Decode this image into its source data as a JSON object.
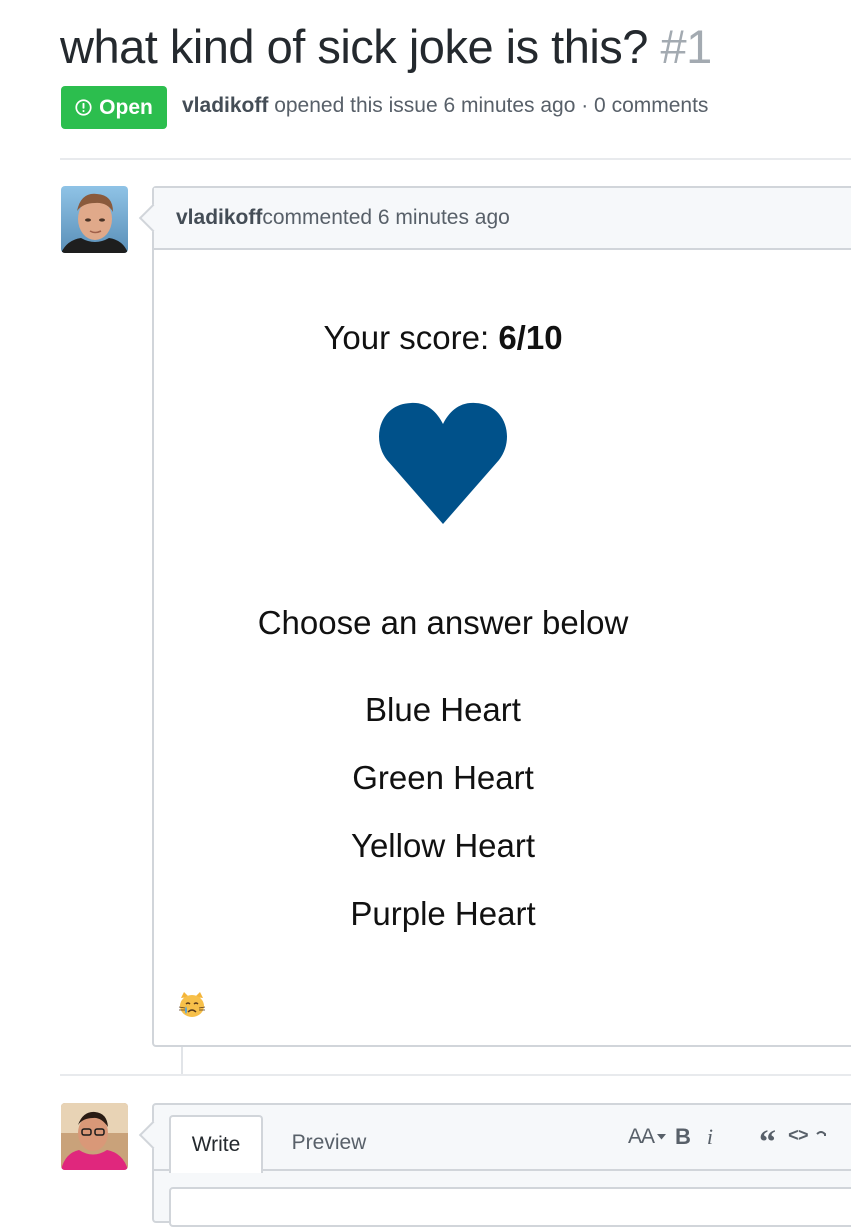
{
  "issue": {
    "title": "what kind of sick joke is this?",
    "number": "#1",
    "state_label": "Open",
    "author": "vladikoff",
    "meta_text": " opened this issue 6 minutes ago · 0 comments"
  },
  "comment": {
    "author": "vladikoff",
    "header_text": " commented 6 minutes ago",
    "quiz": {
      "score_label": "Your score: ",
      "score_value": "6/10",
      "heart_color": "#00518a",
      "prompt": "Choose an answer below",
      "answers": [
        "Blue Heart",
        "Green Heart",
        "Yellow Heart",
        "Purple Heart"
      ]
    },
    "reaction_emoji": "crying-cat-face-icon"
  },
  "editor": {
    "tabs": [
      {
        "label": "Write",
        "active": true
      },
      {
        "label": "Preview",
        "active": false
      }
    ],
    "toolbar": {
      "header_label": "AA",
      "bold_label": "B",
      "italic_label": "i",
      "quote_label": "“",
      "code_label": "<>"
    }
  },
  "colors": {
    "open_green": "#2cbe4e",
    "border": "#d1d5da",
    "header_bg": "#f6f8fa",
    "muted_text": "#586069"
  }
}
